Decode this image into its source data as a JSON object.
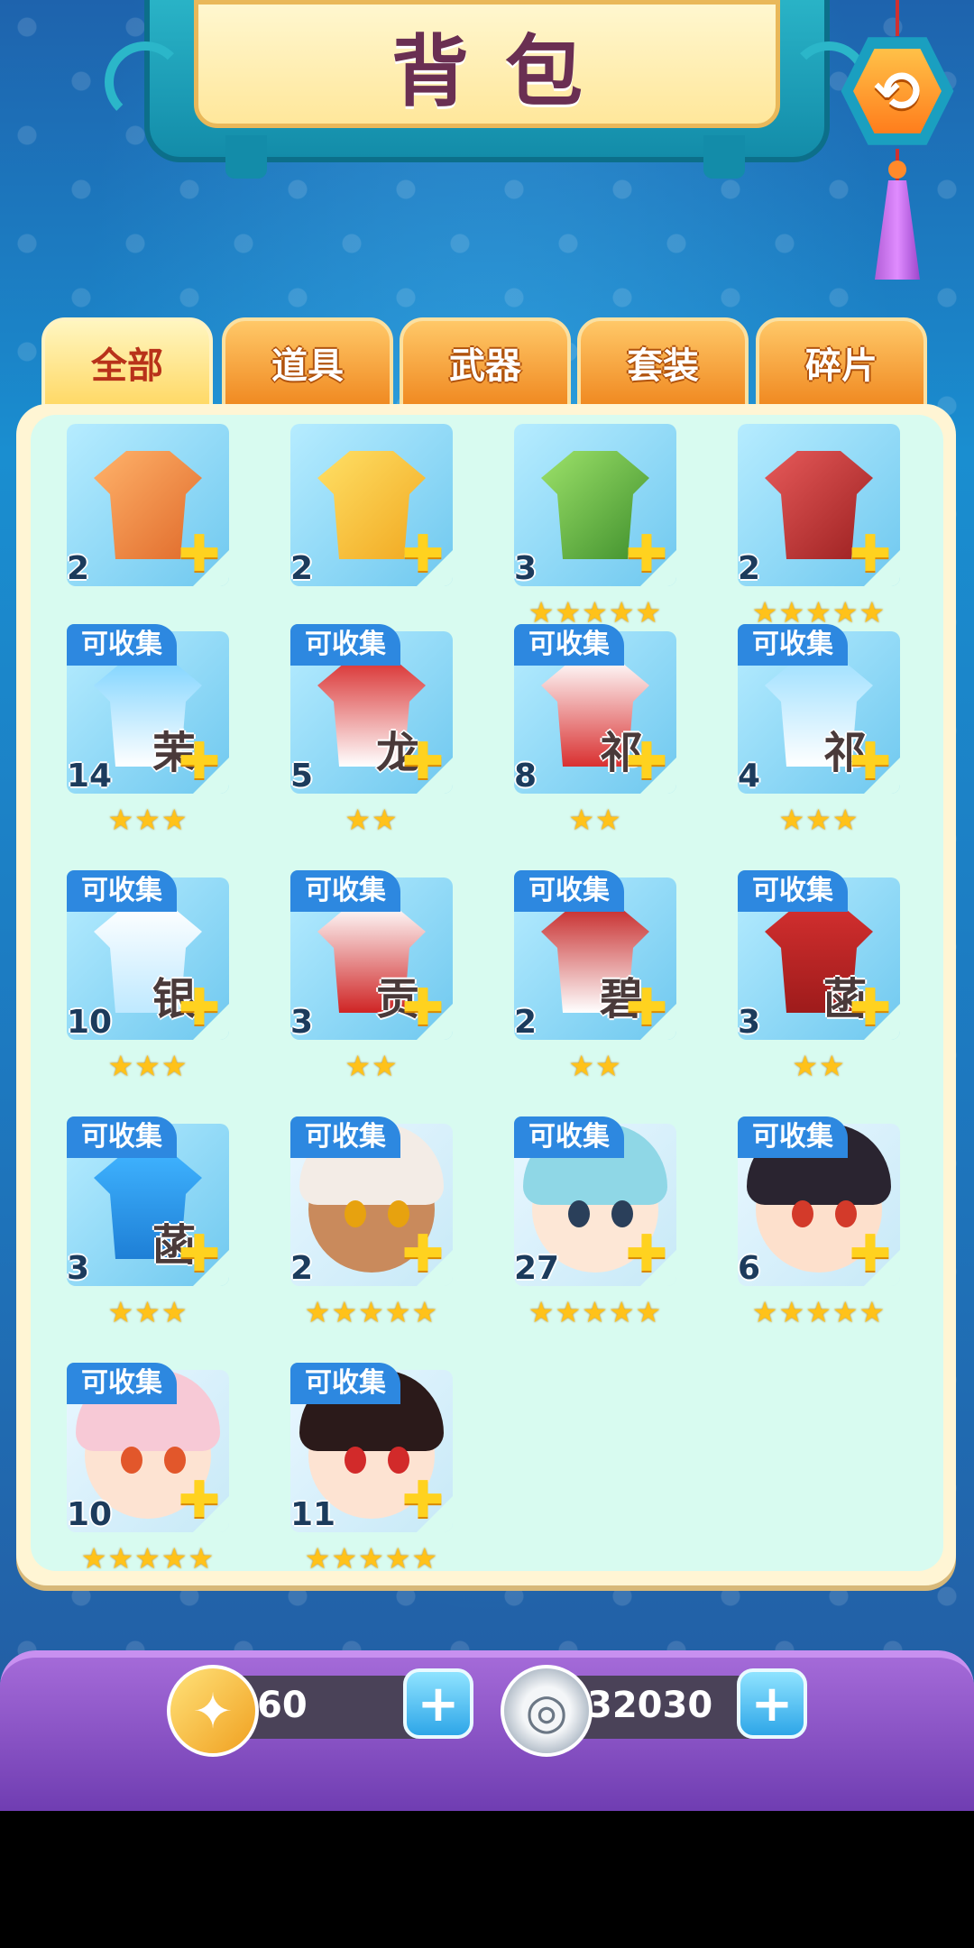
{
  "title": "背包",
  "back_button_glyph": "⟲",
  "tabs": [
    {
      "label": "全部",
      "active": true
    },
    {
      "label": "道具",
      "active": false
    },
    {
      "label": "武器",
      "active": false
    },
    {
      "label": "套装",
      "active": false
    },
    {
      "label": "碎片",
      "active": false
    }
  ],
  "badge_label": "可收集",
  "items": [
    {
      "count": "2",
      "name": "",
      "stars": "",
      "badge": false,
      "art": "boot-icon"
    },
    {
      "count": "2",
      "name": "",
      "stars": "",
      "badge": false,
      "art": "wand-icon"
    },
    {
      "count": "3",
      "name": "",
      "stars": "★★★★★",
      "badge": false,
      "art": "staff-icon"
    },
    {
      "count": "2",
      "name": "",
      "stars": "★★★★★",
      "badge": false,
      "art": "scepter-icon"
    },
    {
      "count": "14",
      "name": "茉",
      "stars": "★★★",
      "badge": true,
      "art": "blue-dress"
    },
    {
      "count": "5",
      "name": "龙",
      "stars": "★★",
      "badge": true,
      "art": "red-dress"
    },
    {
      "count": "8",
      "name": "祁",
      "stars": "★★",
      "badge": true,
      "art": "red-white-dress"
    },
    {
      "count": "4",
      "name": "祁",
      "stars": "★★★",
      "badge": true,
      "art": "white-blue-dress"
    },
    {
      "count": "10",
      "name": "银",
      "stars": "★★★",
      "badge": true,
      "art": "white-robe"
    },
    {
      "count": "3",
      "name": "贡",
      "stars": "★★",
      "badge": true,
      "art": "red-robe"
    },
    {
      "count": "2",
      "name": "碧",
      "stars": "★★",
      "badge": true,
      "art": "red-white-robe"
    },
    {
      "count": "3",
      "name": "菡",
      "stars": "★★",
      "badge": true,
      "art": "red-coat"
    },
    {
      "count": "3",
      "name": "菡",
      "stars": "★★★",
      "badge": true,
      "art": "blue-qipao"
    },
    {
      "count": "2",
      "name": "",
      "stars": "★★★★★",
      "badge": true,
      "art": "white-hair-girl"
    },
    {
      "count": "27",
      "name": "",
      "stars": "★★★★★",
      "badge": true,
      "art": "teal-hair-girl"
    },
    {
      "count": "6",
      "name": "",
      "stars": "★★★★★",
      "badge": true,
      "art": "black-hair-boy"
    },
    {
      "count": "10",
      "name": "",
      "stars": "★★★★★",
      "badge": true,
      "art": "pink-hair-girl"
    },
    {
      "count": "11",
      "name": "",
      "stars": "★★★★★",
      "badge": true,
      "art": "oni-boy"
    }
  ],
  "resources": {
    "leaf_amount": "60",
    "coin_amount": "32030",
    "plus_glyph": "+"
  },
  "colors": {
    "tab_active": "#ffd967",
    "tab_inactive": "#f08a22",
    "badge": "#2d88e0",
    "star": "#ffc21a",
    "panel": "#d8fbf0"
  }
}
